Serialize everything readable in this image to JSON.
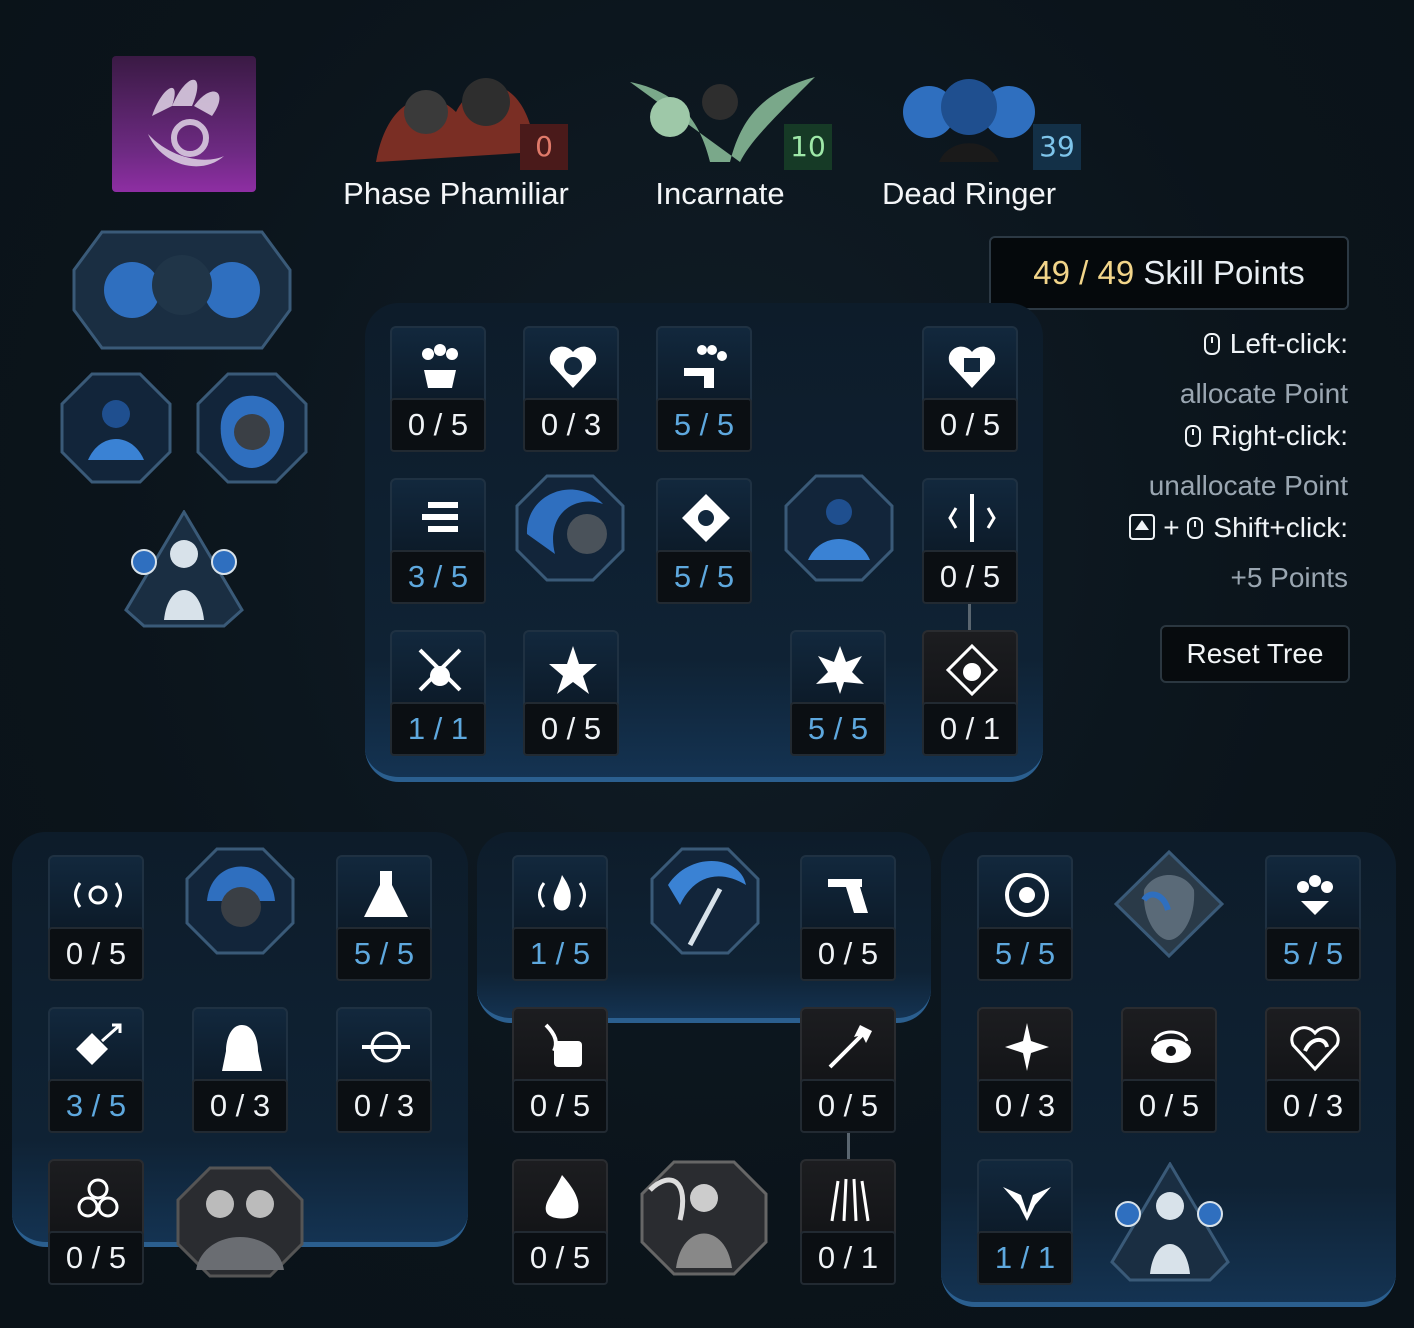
{
  "class_emblem": {
    "icon": "claw-emblem-icon"
  },
  "trees": [
    {
      "name": "Phase Phamiliar",
      "points": "0",
      "color": "#e07a6a"
    },
    {
      "name": "Incarnate",
      "points": "10",
      "color": "#9ee8a8"
    },
    {
      "name": "Dead Ringer",
      "points": "39",
      "color": "#7ec4ea"
    }
  ],
  "skill_points": {
    "current": "49",
    "sep": "/",
    "total": "49",
    "label": "Skill Points"
  },
  "help": {
    "left_click": "Left-click:",
    "left_click_desc": "allocate Point",
    "right_click": "Right-click:",
    "right_click_desc": "unallocate Point",
    "plus": "+",
    "shift_click": "Shift+click:",
    "shift_click_desc": "+5 Points"
  },
  "reset_label": "Reset Tree",
  "upper_panel": {
    "row1": [
      "0 / 5",
      "0 / 3",
      "5 / 5",
      "0 / 5"
    ],
    "row2": [
      "3 / 5",
      "5 / 5",
      "0 / 5"
    ],
    "row3": [
      "1 / 1",
      "0 / 5",
      "5 / 5",
      "0 / 1"
    ]
  },
  "left_panel": {
    "row1": [
      "0 / 5",
      "5 / 5"
    ],
    "row2": [
      "3 / 5",
      "0 / 3",
      "0 / 3"
    ],
    "row3": [
      "0 / 5"
    ]
  },
  "middle_panel": {
    "row1": [
      "1 / 5",
      "0 / 5"
    ],
    "row2": [
      "0 / 5",
      "0 / 5"
    ],
    "row3": [
      "0 / 5",
      "0 / 1"
    ]
  },
  "right_panel": {
    "row1": [
      "5 / 5",
      "5 / 5"
    ],
    "row2": [
      "0 / 3",
      "0 / 5",
      "0 / 3"
    ],
    "row3": [
      "1 / 1"
    ]
  },
  "colors": {
    "maxed": "#5ea8de",
    "gold": "#f2d58a",
    "panel_edge": "#2b5f8f"
  }
}
